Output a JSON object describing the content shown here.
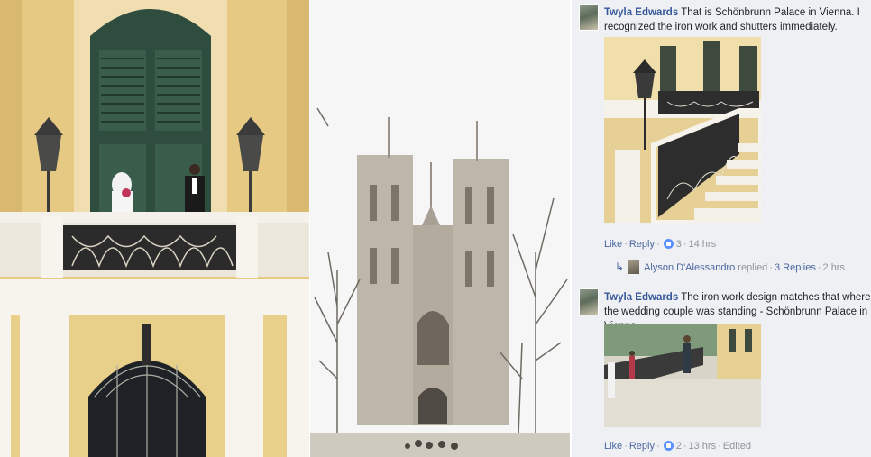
{
  "photos": {
    "left_name": "palace-balcony-photo",
    "middle_name": "cathedral-photo"
  },
  "comments": [
    {
      "author": "Twyla Edwards",
      "text": "That is Schönbrunn Palace in Vienna. I recognized the iron work and shutters immediately.",
      "like_label": "Like",
      "reply_label": "Reply",
      "reactions": "3",
      "time": "14 hrs",
      "reply_summary": {
        "name": "Alyson D'Alessandro",
        "action": "replied",
        "count": "3 Replies",
        "time": "2 hrs"
      }
    },
    {
      "author": "Twyla Edwards",
      "text": "The iron work design matches that where the wedding couple was standing - Schönbrunn Palace in Vienna.",
      "like_label": "Like",
      "reply_label": "Reply",
      "reactions": "2",
      "time": "13 hrs",
      "edited": "Edited"
    }
  ],
  "colors": {
    "link": "#365899",
    "meta": "#90949c",
    "panel_bg": "#eef0f3",
    "like_badge": "#5890ff"
  },
  "icons": [
    "like-icon",
    "reply-arrow-icon"
  ]
}
